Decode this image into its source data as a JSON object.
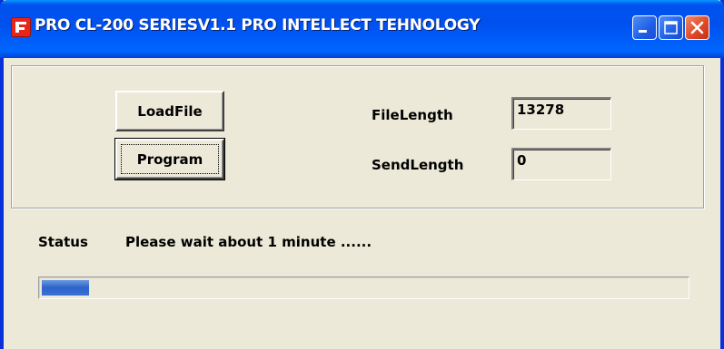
{
  "window": {
    "title": "PRO CL-200 SERIESV1.1 PRO INTELLECT TEHNOLOGY",
    "icon": "app-logo-icon",
    "controls": [
      "minimize-icon",
      "maximize-icon",
      "close-icon"
    ]
  },
  "buttons": {
    "load_file": "LoadFile",
    "program": "Program"
  },
  "fields": {
    "file_length_label": "FileLength",
    "file_length_value": "13278",
    "send_length_label": "SendLength",
    "send_length_value": "0"
  },
  "status": {
    "label": "Status",
    "message": "Please wait about 1 minute ......"
  },
  "progress": {
    "fraction": 0.074
  },
  "colors": {
    "titlebar": "#0053ee",
    "window_bg": "#ece9d8",
    "progress_fill": "#2b63c9",
    "close_button": "#e04b2a"
  }
}
